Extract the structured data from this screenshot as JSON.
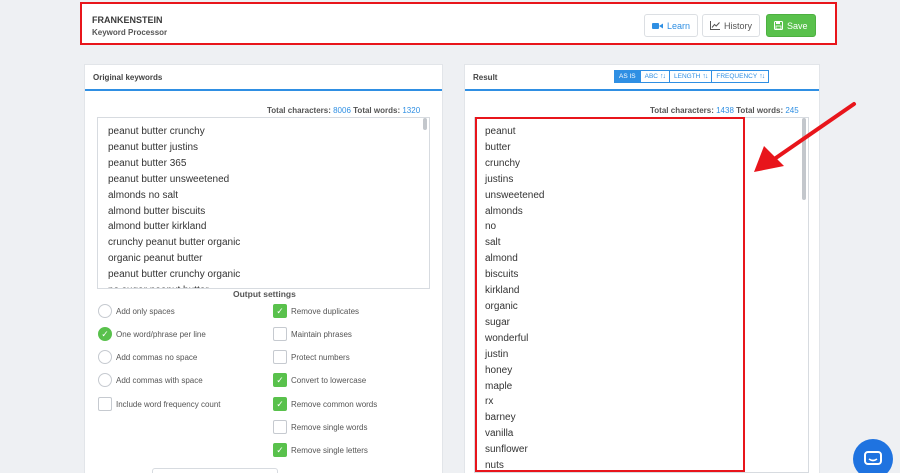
{
  "header": {
    "app_name": "FRANKENSTEIN",
    "app_subtitle": "Keyword Processor",
    "learn_label": "Learn",
    "history_label": "History",
    "save_label": "Save"
  },
  "original": {
    "title": "Original keywords",
    "total_chars_label": "Total characters:",
    "total_chars": "8006",
    "total_words_label": "Total words:",
    "total_words": "1320",
    "lines": [
      "peanut butter crunchy",
      "peanut butter justins",
      "peanut butter 365",
      "peanut butter unsweetened",
      "almonds no salt",
      "almond butter biscuits",
      "almond butter kirkland",
      "crunchy peanut butter organic",
      "organic peanut butter",
      "peanut butter crunchy organic",
      "no sugar peanut butter"
    ]
  },
  "output_settings": {
    "title": "Output settings",
    "left_options": [
      {
        "label": "Add only spaces",
        "selected": false,
        "kind": "radio"
      },
      {
        "label": "One word/phrase per line",
        "selected": true,
        "kind": "radio"
      },
      {
        "label": "Add commas no space",
        "selected": false,
        "kind": "radio"
      },
      {
        "label": "Add commas with space",
        "selected": false,
        "kind": "radio"
      },
      {
        "label": "Include word frequency count",
        "selected": false,
        "kind": "checkbox"
      }
    ],
    "right_options": [
      {
        "label": "Remove duplicates",
        "checked": true
      },
      {
        "label": "Maintain phrases",
        "checked": false
      },
      {
        "label": "Protect numbers",
        "checked": false
      },
      {
        "label": "Convert to lowercase",
        "checked": true
      },
      {
        "label": "Remove common words",
        "checked": true
      },
      {
        "label": "Remove single words",
        "checked": false
      },
      {
        "label": "Remove single letters",
        "checked": true
      }
    ]
  },
  "result": {
    "title": "Result",
    "sort": {
      "as_is": "AS IS",
      "abc": "ABC",
      "length": "LENGTH",
      "frequency": "FREQUENCY",
      "active": "AS IS"
    },
    "total_chars_label": "Total characters:",
    "total_chars": "1438",
    "total_words_label": "Total words:",
    "total_words": "245",
    "lines": [
      "peanut",
      "butter",
      "crunchy",
      "justins",
      "unsweetened",
      "almonds",
      "no",
      "salt",
      "almond",
      "biscuits",
      "kirkland",
      "organic",
      "sugar",
      "wonderful",
      "justin",
      "honey",
      "maple",
      "rx",
      "barney",
      "vanilla",
      "sunflower",
      "nuts"
    ]
  },
  "colors": {
    "accent": "#2f8fe3",
    "save_green": "#59c14c",
    "annotation_red": "#e8151b",
    "chat_blue": "#1f73e0"
  },
  "icons": {
    "learn": "video-camera-icon",
    "history": "chart-line-icon",
    "save": "floppy-disk-icon",
    "chat": "chat-bubble-icon"
  }
}
